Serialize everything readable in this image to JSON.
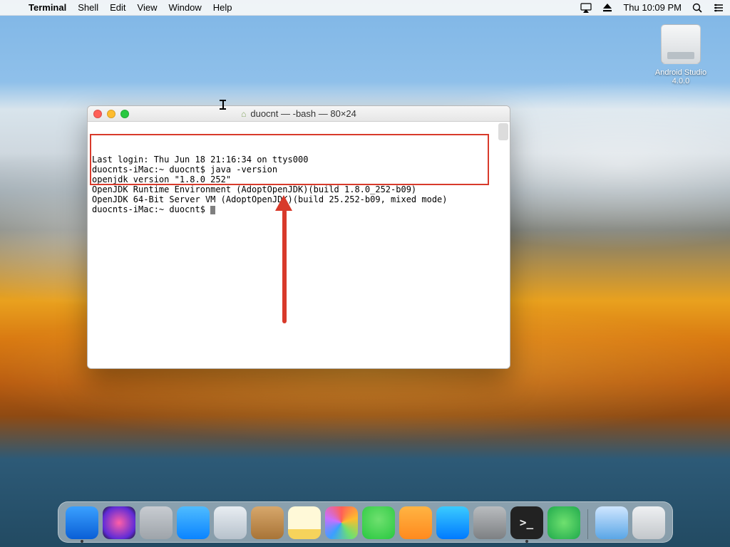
{
  "menubar": {
    "app_name": "Terminal",
    "items": [
      "Shell",
      "Edit",
      "View",
      "Window",
      "Help"
    ],
    "clock": "Thu 10:09 PM"
  },
  "desktop_icon": {
    "label_line1": "Android Studio",
    "label_line2": "4.0.0"
  },
  "terminal": {
    "title": "duocnt — -bash — 80×24",
    "lines": [
      "Last login: Thu Jun 18 21:16:34 on ttys000",
      "duocnts-iMac:~ duocnt$ java -version",
      "openjdk version \"1.8.0_252\"",
      "OpenJDK Runtime Environment (AdoptOpenJDK)(build 1.8.0_252-b09)",
      "OpenJDK 64-Bit Server VM (AdoptOpenJDK)(build 25.252-b09, mixed mode)",
      "duocnts-iMac:~ duocnt$ "
    ]
  },
  "dock": [
    {
      "name": "finder",
      "running": true
    },
    {
      "name": "siri",
      "running": false
    },
    {
      "name": "launchpad",
      "running": false
    },
    {
      "name": "safari",
      "running": false
    },
    {
      "name": "mail",
      "running": false
    },
    {
      "name": "contacts",
      "running": false
    },
    {
      "name": "notes",
      "running": false
    },
    {
      "name": "photos",
      "running": false
    },
    {
      "name": "messages",
      "running": false
    },
    {
      "name": "ibooks",
      "running": false
    },
    {
      "name": "appstore",
      "running": false
    },
    {
      "name": "sysprefs",
      "running": false
    },
    {
      "name": "terminal",
      "running": true
    },
    {
      "name": "androidstudio",
      "running": false
    },
    {
      "name": "__sep__"
    },
    {
      "name": "vbox",
      "running": false
    },
    {
      "name": "trash",
      "running": false
    }
  ]
}
